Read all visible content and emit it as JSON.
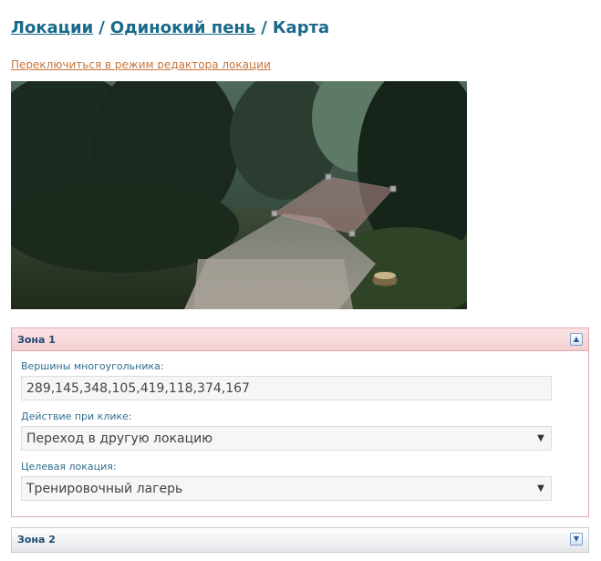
{
  "breadcrumb": {
    "root": "Локации",
    "parent": "Одинокий пень",
    "current": "Карта",
    "separator": "/"
  },
  "switch_link": "Переключиться в режим редактора локации",
  "map": {
    "polygon_vertices": "289,145,348,105,419,118,374,167"
  },
  "zone1": {
    "title": "Зона 1",
    "toggle_icon": "▲",
    "vertices_label": "Вершины многоугольника:",
    "vertices_value": "289,145,348,105,419,118,374,167",
    "action_label": "Действие при клике:",
    "action_value": "Переход в другую локацию",
    "target_label": "Целевая локация:",
    "target_value": "Тренировочный лагерь",
    "caret": "▼"
  },
  "zone2": {
    "title": "Зона 2",
    "toggle_icon": "▼"
  },
  "colors": {
    "link": "#1a6a8a",
    "switch_link": "#c8743a",
    "zone_border": "#e3a8ae"
  }
}
